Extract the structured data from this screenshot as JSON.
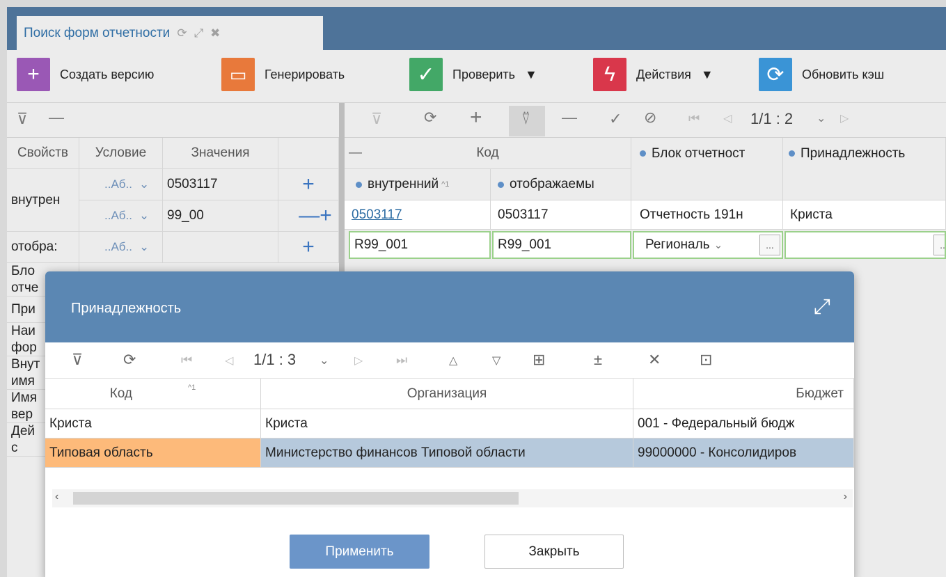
{
  "tab": {
    "title": "Поиск форм отчетности",
    "refresh_icon": "refresh-icon",
    "expand_icon": "expand-icon",
    "close_icon": "close-icon"
  },
  "toolbar": {
    "create_version": "Создать версию",
    "generate": "Генерировать",
    "check": "Проверить",
    "actions": "Действия",
    "refresh_cache": "Обновить кэш",
    "dropdown_arrow": "▼",
    "colors": {
      "create": "#9a58b5",
      "generate": "#e8793b",
      "check": "#43a867",
      "actions": "#d9374b",
      "refresh": "#3a94d6"
    }
  },
  "filter_panel": {
    "headers": [
      "Свойств",
      "Условие",
      "Значения"
    ],
    "rows": [
      {
        "property": "внутрен",
        "conditions": [
          {
            "op": "..Аб..",
            "value": "0503117"
          },
          {
            "op": "..Аб..",
            "value": "99_00"
          }
        ]
      },
      {
        "property": "отобра:",
        "conditions": [
          {
            "op": "..Аб..",
            "value": ""
          }
        ]
      }
    ],
    "hidden_labels": [
      "Бло",
      "отче",
      "При",
      "Наи",
      "фор",
      "Внут",
      "имя",
      "Имя",
      "вер",
      "Дей",
      "с"
    ]
  },
  "grid": {
    "pager": "1/1 : 2",
    "group_header": "Код",
    "columns": [
      "внутренний",
      "отображаемы",
      "Блок отчетност",
      "Принадлежность"
    ],
    "rows": [
      [
        "0503117",
        "0503117",
        "Отчетность 191н",
        "Криста"
      ],
      [
        "R99_001",
        "R99_001",
        "Региональ",
        ""
      ]
    ],
    "ellipsis": "..."
  },
  "dialog": {
    "title": "Принадлежность",
    "pager": "1/1 : 3",
    "columns": [
      "Код",
      "Организация",
      "Бюджет"
    ],
    "sort_marker": "^1",
    "rows": [
      [
        "Криста",
        "Криста",
        "001 - Федеральный бюдж"
      ],
      [
        "Типовая область",
        "Министерство финансов Типовой области",
        "99000000 - Консолидиров"
      ]
    ],
    "apply": "Применить",
    "close": "Закрыть"
  }
}
